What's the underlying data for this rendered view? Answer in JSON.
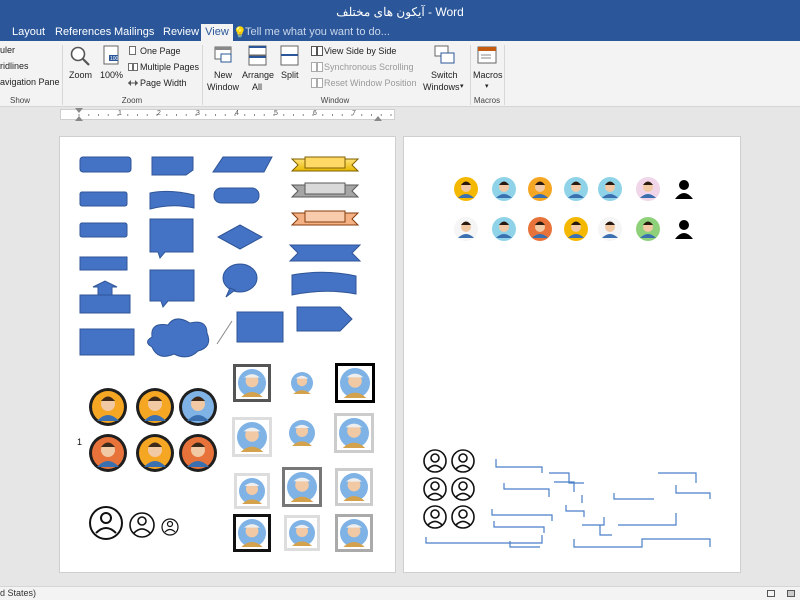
{
  "app": {
    "title": "آیکون های مختلف - Word"
  },
  "tabs": [
    {
      "label": "Layout",
      "active": false
    },
    {
      "label": "References",
      "active": false
    },
    {
      "label": "Mailings",
      "active": false
    },
    {
      "label": "Review",
      "active": false
    },
    {
      "label": "View",
      "active": true
    }
  ],
  "tell_me": {
    "placeholder": "Tell me what you want to do..."
  },
  "ribbon": {
    "show": {
      "items": [
        "uler",
        "ridlines",
        "avigation Pane"
      ],
      "group_label": "Show"
    },
    "zoom": {
      "zoom_label": "Zoom",
      "zoom100_label": "100%",
      "one_page": "One Page",
      "multiple_pages": "Multiple Pages",
      "page_width": "Page Width",
      "group_label": "Zoom"
    },
    "window": {
      "new_window": [
        "New",
        "Window"
      ],
      "arrange_all": [
        "Arrange",
        "All"
      ],
      "split": "Split",
      "view_side_by_side": "View Side by Side",
      "synchronous_scrolling": "Synchronous Scrolling",
      "reset_window_position": "Reset Window Position",
      "switch_windows": [
        "Switch",
        "Windows"
      ],
      "group_label": "Window"
    },
    "macros": {
      "label": "Macros",
      "group_label": "Macros"
    }
  },
  "ruler": {
    "ticks": [
      "1",
      "2",
      "3",
      "4",
      "5",
      "6",
      "7"
    ]
  },
  "document": {
    "stray_char": "1"
  },
  "status": {
    "text": "d States)"
  },
  "colors": {
    "brand": "#2b579a",
    "shape_blue": "#4472c4",
    "shape_border": "#2f5597"
  },
  "icons": [
    "magnifier-icon",
    "window-icon",
    "avatar-icon",
    "user-outline-icon"
  ]
}
